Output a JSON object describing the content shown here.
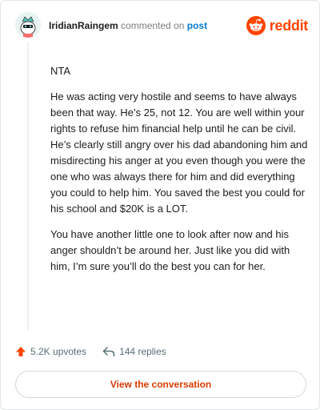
{
  "header": {
    "username": "IridianRaingem",
    "action_text": "commented on",
    "post_link": "post",
    "logo_text": "reddit"
  },
  "comment": {
    "paragraphs": [
      "NTA",
      "He was acting very hostile and seems to have always been that way. He’s 25, not 12. You are well within your rights to refuse him financial help until he can be civil. He’s clearly still angry over his dad abandoning him and misdirecting his anger at you even though you were the one who was always there for him and did everything you could to help him. You saved the best you could for his school and $20K is a LOT.",
      "You have another little one to look after now and his anger shouldn’t be around her. Just like you did with him, I’m sure you’ll do the best you can for her."
    ]
  },
  "actions": {
    "upvotes": "5.2K upvotes",
    "replies": "144 replies"
  },
  "cta": {
    "label": "View the conversation"
  },
  "colors": {
    "brand": "#ff4500",
    "link": "#0079d3",
    "cta_text": "#d93a00",
    "meta": "#576f76"
  },
  "icons": {
    "avatar": "snoo-avatar-icon",
    "logo": "reddit-logo-icon",
    "upvote": "upvote-arrow-icon",
    "reply": "reply-arrow-icon"
  }
}
